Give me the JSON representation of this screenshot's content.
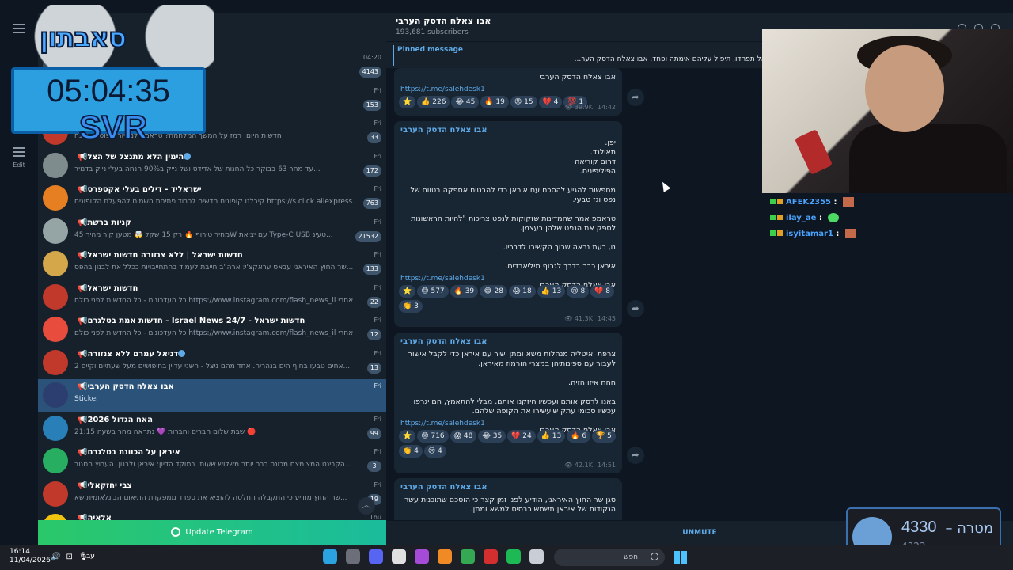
{
  "stream_overlay": {
    "logo_text": "סאבתון",
    "timer": "05:04:35",
    "tag": "SVR"
  },
  "rail": {
    "edit_label": "Edit"
  },
  "chats": [
    {
      "name": "",
      "msg": "לא לרתוח אדון עזריאל הקבוצה סגורה לכ",
      "time": "04:20",
      "badge": "4143",
      "avatar": "#3a4a5a"
    },
    {
      "name": "",
      "msg": "",
      "time": "Fri",
      "badge": "153",
      "avatar": "#3a4a5a"
    },
    {
      "name": "",
      "msg": "חדשות היום: רמז על המשך המלחמה? טראמפ לניו יורק פוסט: \"אנח",
      "time": "Fri",
      "badge": "33",
      "avatar": "#c0392b"
    },
    {
      "name": "הימין הלא מתנצל של הצל",
      "msg": "עד מחר 63 בבוקר כל החנות של אדידס ושל נייק ב90% הנחה  בעלי נייק בדמיר...",
      "time": "Fri",
      "badge": "172",
      "avatar": "#7f8c8d",
      "verified": true
    },
    {
      "name": "ישראליד - דילים בעלי אקספרס",
      "msg": "קיבלנו קופונים חדשים לכבוד פתיחת השמים להפעלת הקופונים https://s.click.aliexpress.co...",
      "time": "Fri",
      "badge": "763",
      "avatar": "#e67e22"
    },
    {
      "name": "קניות ברשת",
      "msg": "מחיר טירוף 🔥 רק 15 שקל 🤯 מטען קיר מהיר 45W עם יציאת Type-C USB  טעינ...",
      "time": "Fri",
      "badge": "21532",
      "avatar": "#95a5a6"
    },
    {
      "name": "חדשות ישראל | ללא צנזורה חדשות ישראל",
      "msg": "שר החוץ האיראני עבאס עראקצ'י: ארה\"ב חייבת לעמוד בהתחייבויות ככלל את לבנון בהפס...",
      "time": "Fri",
      "badge": "133",
      "avatar": "#d4a84a"
    },
    {
      "name": "חדשות ישראל",
      "msg": "כל העדכונים - כל החדשות לפני כולם  https://www.instagram.com/flash_news_il  עקבו אחרי...",
      "time": "Fri",
      "badge": "22",
      "avatar": "#c0392b"
    },
    {
      "name": "חדשות ישראל - Israel News 24/7 - חדשות אמת בטלגרם",
      "msg": "כל העדכונים - כל החדשות לפני כולם  https://www.instagram.com/flash_news_il  עקבו אחרי...",
      "time": "Fri",
      "badge": "12",
      "avatar": "#e74c3c"
    },
    {
      "name": "דניאל עמרם ללא צנזורה",
      "msg": "2 אחים טבעו בחוף הים בנהריה. אחד מהם ניצל - השני עדיין בחיפושים מעל שעתיים וקיים...",
      "time": "Fri",
      "badge": "13",
      "avatar": "#c0392b",
      "verified": true
    },
    {
      "name": "אבו צאלח הדסק הערבי",
      "msg": "Sticker",
      "time": "Fri",
      "badge": "",
      "avatar": "#2c3e70",
      "active": true
    },
    {
      "name": "האח הגדול 2026",
      "msg": "שבת שלום חברים וחברות 💜 נתראה מחר בשעה 21:15 🔴",
      "time": "Fri",
      "badge": "99",
      "avatar": "#2980b9"
    },
    {
      "name": "איראן על הכוונת בטלגרם",
      "msg": "הקבינט המצומצם מכונס כבר יותר משלוש שעות. במוקד הדיון: איראן ולבנון. הערוץ הסגור...",
      "time": "Fri",
      "badge": "3",
      "avatar": "#27ae60"
    },
    {
      "name": "צבי יחזקאלי",
      "msg": "שר החוץ מודיע כי התקבלה החלטה להוציא את ספרד ממפקדת התיאום הבינלאומית שא...",
      "time": "Fri",
      "badge": "19",
      "avatar": "#c0392b"
    },
    {
      "name": "אלאיה",
      "msg": "",
      "time": "Thu",
      "badge": "",
      "avatar": "#f1c40f"
    }
  ],
  "update_label": "Update Telegram",
  "channel": {
    "title": "אבו צאלח הדסק הערבי",
    "subscribers": "193,681 subscribers",
    "pinned_label": "Pinned message",
    "pinned_text": "אבו צאלח הדסק הערבי     \"בְּסֻנָּרִים מִקָּטֹן וְעַד־גָּדוֹל וְיִלְאוּ לִמְצֹא הַפָּתַח. אל תיראו ואל תפחדו, תיפול עליהם אימתה ופחד.   אבו צאלח הדסק הער..."
  },
  "messages": [
    {
      "author": "",
      "body": "אבו צאלח הדסק הערבי",
      "link": "https://t.me/salehdesk1",
      "reactions": [
        "⭐",
        "👍 226",
        "😂 45",
        "🔥 19",
        "😡 15",
        "💔 4",
        "💯 1"
      ],
      "views": "39.9K",
      "time": "14:42"
    },
    {
      "author": "אבו צאלח הדסק הערבי",
      "body": "יפן.\nתאילנד.\nדרום קוריאה\nהפיליפינים.\n\nמחפשות להגיע להסכם עם איראן כדי להבטיח אספקה בטווח של נפט וגז טבעי.\n\nטראמפ אמר שהמדינות שזקוקות לנפט צריכות \"להיות הראשונות לספק את הנפט שלהן בעצמן.\n\nנו, כעת נראה שרוך הקשיבו לדבריו.\n\nאיראן כבר בדרך לגרוף מיליארדים.\n\nאבו צאלח הדסק הערבי",
      "link": "https://t.me/salehdesk1",
      "reactions": [
        "⭐",
        "😡 577",
        "🔥 39",
        "😂 28",
        "😱 18",
        "👍 13",
        "😢 8",
        "💔 8",
        "👏 3"
      ],
      "views": "41.3K",
      "time": "14:45"
    },
    {
      "author": "אבו צאלח הדסק הערבי",
      "body": "צרפת ואיטליה מנהלות משא ומתן ישיר עם איראן כדי לקבל אישור לעבור עם ספינותיהן במצרי הורמוז מאיראן.\n\nחחח איזו הזיה.\n\nבאנו לרסק אותם ועכשיו חיזקנו אותם. מבלי להתאמץ, הם יגרפו עכשיו סכומי עתק שיעשירו את הקופה שלהם.\n\nאבו צאלח הדסק הערבי",
      "link": "https://t.me/salehdesk1",
      "reactions": [
        "⭐",
        "😡 716",
        "😱 48",
        "😂 35",
        "💔 24",
        "👍 13",
        "🔥 6",
        "🏆 5",
        "👏 4",
        "😢 4"
      ],
      "views": "42.1K",
      "time": "14:51"
    },
    {
      "author": "אבו צאלח הדסק הערבי",
      "body": "סגן שר החוץ האיראני, הודיע לפני זמן קצר כי הוסכם שתוכנית עשר הנקודות של איראן תשמש כבסיס למשא ומתן.",
      "link": "",
      "reactions": [],
      "views": "",
      "time": ""
    }
  ],
  "unmute_label": "UNMUTE",
  "stream_chat": [
    {
      "user": "AFEK2355",
      "emote": "face"
    },
    {
      "user": "ilay_ae",
      "emote": "green"
    },
    {
      "user": "isyitamar1",
      "emote": "face"
    }
  ],
  "goal": {
    "label": "מטרה –",
    "current": "4330",
    "sub": "4323"
  },
  "taskbar": {
    "time": "16:14",
    "date": "11/04/2026",
    "lang": "עבר",
    "search": "חפש"
  }
}
